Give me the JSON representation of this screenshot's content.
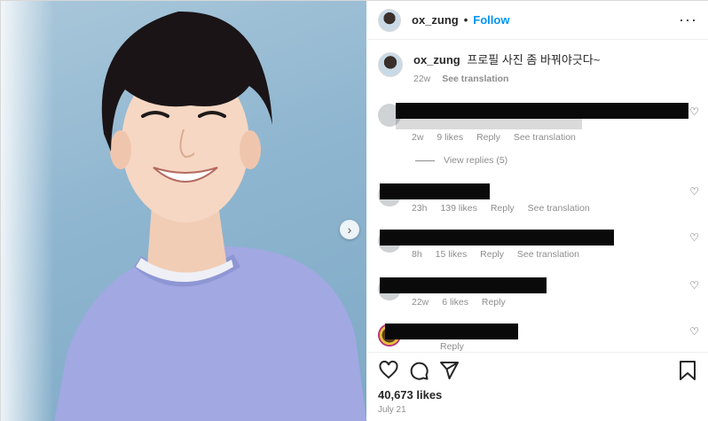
{
  "post": {
    "username": "ox_zung",
    "separator": "•",
    "follow_label": "Follow",
    "more_icon": "more-horizontal-icon"
  },
  "caption": {
    "username": "ox_zung",
    "text": "프로필 사진 좀 바꿔야긋다~",
    "age": "22w",
    "translate_label": "See translation"
  },
  "comments": [
    {
      "redacted_text": "Redacted comment",
      "age": "2w",
      "likes": "9 likes",
      "reply": "Reply",
      "translate": "See translation",
      "view_replies": "View replies (5)"
    },
    {
      "redacted_text": "Redacted comment",
      "age": "23h",
      "likes": "139 likes",
      "reply": "Reply",
      "translate": "See translation"
    },
    {
      "redacted_text": "Redacted comment",
      "age": "8h",
      "likes": "15 likes",
      "reply": "Reply",
      "translate": "See translation"
    },
    {
      "redacted_text": "Redacted comment",
      "age": "22w",
      "likes": "6 likes",
      "reply": "Reply"
    },
    {
      "redacted_text": "Redacted comment",
      "age": "",
      "likes": "",
      "reply": "Reply"
    }
  ],
  "footer": {
    "likes_count": "40,673 likes",
    "date": "July 21"
  },
  "icons": {
    "like": "heart-icon",
    "comment": "comment-icon",
    "share": "share-icon",
    "save": "bookmark-icon",
    "next": "chevron-right-icon"
  },
  "colors": {
    "accent": "#0095f6",
    "muted": "#8e8e8e",
    "text": "#262626",
    "photo_bg": "#8fb6d0",
    "sweater": "#9ea6e0"
  }
}
